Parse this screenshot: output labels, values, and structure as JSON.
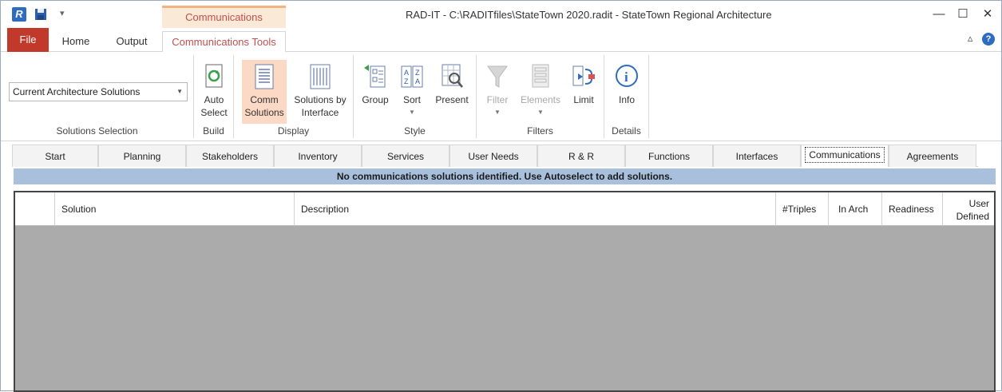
{
  "titlebar": {
    "app_icon_letter": "R",
    "context_tab_header": "Communications",
    "window_title": "RAD-IT - C:\\RADITfiles\\StateTown 2020.radit - StateTown Regional Architecture",
    "minimize_glyph": "—",
    "maximize_glyph": "☐",
    "close_glyph": "✕"
  },
  "ribbon_tabs": {
    "file": "File",
    "home": "Home",
    "output": "Output",
    "comm_tools": "Communications Tools"
  },
  "ribbon_help": {
    "collapse_glyph": "▵",
    "help_glyph": "?"
  },
  "ribbon": {
    "solutions_selection": {
      "combo_value": "Current Architecture Solutions",
      "label": "Solutions Selection"
    },
    "build": {
      "auto_select_line1": "Auto",
      "auto_select_line2": "Select",
      "label": "Build"
    },
    "display": {
      "comm_solutions_line1": "Comm",
      "comm_solutions_line2": "Solutions",
      "by_interface_line1": "Solutions by",
      "by_interface_line2": "Interface",
      "label": "Display"
    },
    "style": {
      "group": "Group",
      "sort": "Sort",
      "present": "Present",
      "label": "Style"
    },
    "filters": {
      "filter": "Filter",
      "elements": "Elements",
      "limit": "Limit",
      "label": "Filters"
    },
    "details": {
      "info": "Info",
      "label": "Details"
    }
  },
  "nav_tabs": [
    "Start",
    "Planning",
    "Stakeholders",
    "Inventory",
    "Services",
    "User Needs",
    "R & R",
    "Functions",
    "Interfaces",
    "Communications",
    "Agreements"
  ],
  "info_message": "No communications solutions identified.  Use Autoselect to add solutions.",
  "grid": {
    "columns": {
      "solution": "Solution",
      "description": "Description",
      "triples": "#Triples",
      "in_arch": "In Arch",
      "readiness": "Readiness",
      "user_defined_line1": "User",
      "user_defined_line2": "Defined"
    }
  },
  "colors": {
    "accent": "#c0504d",
    "file_tab": "#c0392b",
    "selected_button": "#fbd9c4",
    "info_bar": "#a8c0dc",
    "grid_empty": "#ababab"
  }
}
